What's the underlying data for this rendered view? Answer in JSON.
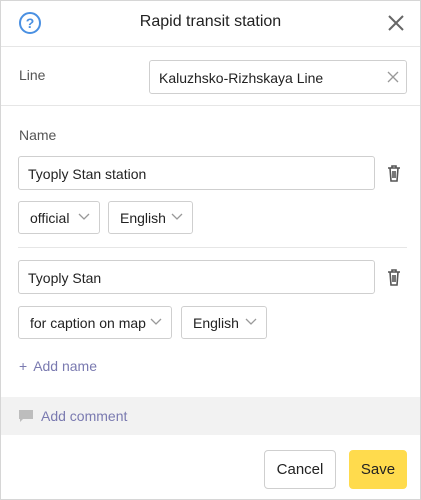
{
  "dialog": {
    "title": "Rapid transit station",
    "help_icon": "question-circle-icon",
    "close_icon": "close-icon"
  },
  "line": {
    "label": "Line",
    "value": "Kaluzhsko-Rizhskaya Line"
  },
  "names": {
    "label": "Name",
    "items": [
      {
        "value": "Tyoply Stan station",
        "type": "official",
        "language": "English"
      },
      {
        "value": "Tyoply Stan",
        "type": "for caption on map",
        "language": "English"
      }
    ],
    "add_label": "Add name",
    "add_prefix": "+"
  },
  "comment": {
    "label": "Add comment"
  },
  "buttons": {
    "cancel": "Cancel",
    "save": "Save"
  },
  "colors": {
    "accent": "#ffdb4d",
    "link": "#7a7ab0",
    "help": "#4a90e2"
  }
}
